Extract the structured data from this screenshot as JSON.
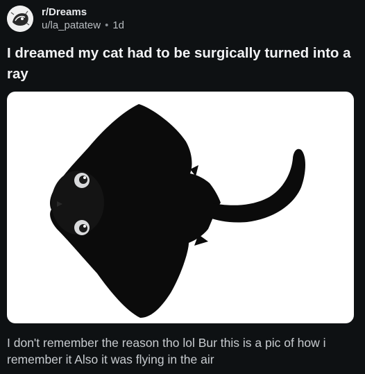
{
  "post": {
    "subreddit": "r/Dreams",
    "username": "u/la_patatew",
    "separator": "•",
    "age": "1d",
    "title": "I dreamed my cat had to be surgically turned into a ray",
    "body": "I don't remember the reason tho lol Bur this is a pic of how i remember it Also it was flying in the air"
  },
  "icons": {
    "avatar": "subreddit-avatar-icon"
  },
  "colors": {
    "background": "#0e1113",
    "title": "#f2f3f5",
    "media_background": "#ffffff"
  }
}
